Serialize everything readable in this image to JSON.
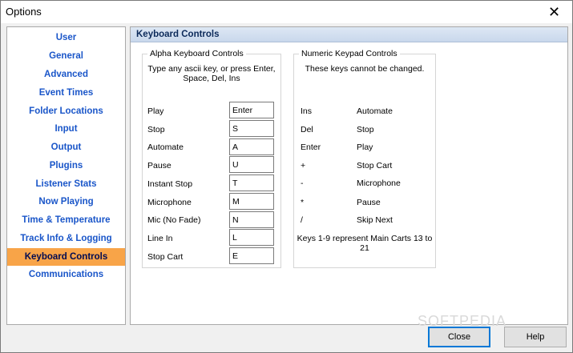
{
  "window": {
    "title": "Options"
  },
  "sidebar": {
    "items": [
      "User",
      "General",
      "Advanced",
      "Event Times",
      "Folder Locations",
      "Input",
      "Output",
      "Plugins",
      "Listener Stats",
      "Now Playing",
      "Time & Temperature",
      "Track Info & Logging",
      "Keyboard Controls",
      "Communications"
    ],
    "active_label": "Keyboard Controls"
  },
  "panel": {
    "title": "Keyboard Controls"
  },
  "alpha": {
    "group_title": "Alpha Keyboard Controls",
    "description": "Type any ascii key, or press Enter, Space, Del, Ins",
    "rows": [
      {
        "label": "Play",
        "key": "Enter"
      },
      {
        "label": "Stop",
        "key": "S"
      },
      {
        "label": "Automate",
        "key": "A"
      },
      {
        "label": "Pause",
        "key": "U"
      },
      {
        "label": "Instant Stop",
        "key": "T"
      },
      {
        "label": "Microphone",
        "key": "M"
      },
      {
        "label": "Mic (No Fade)",
        "key": "N"
      },
      {
        "label": "Line In",
        "key": "L"
      },
      {
        "label": "Stop Cart",
        "key": "E"
      }
    ]
  },
  "numeric": {
    "group_title": "Numeric Keypad Controls",
    "description": "These keys cannot be changed.",
    "rows": [
      {
        "key": "Ins",
        "action": "Automate"
      },
      {
        "key": "Del",
        "action": "Stop"
      },
      {
        "key": "Enter",
        "action": "Play"
      },
      {
        "key": "+",
        "action": "Stop Cart"
      },
      {
        "key": "-",
        "action": "Microphone"
      },
      {
        "key": "*",
        "action": "Pause"
      },
      {
        "key": "/",
        "action": "Skip Next"
      }
    ],
    "footnote": "Keys 1-9 represent Main Carts 13 to 21"
  },
  "buttons": {
    "close": "Close",
    "help": "Help"
  },
  "watermark": "SOFTPEDIA"
}
